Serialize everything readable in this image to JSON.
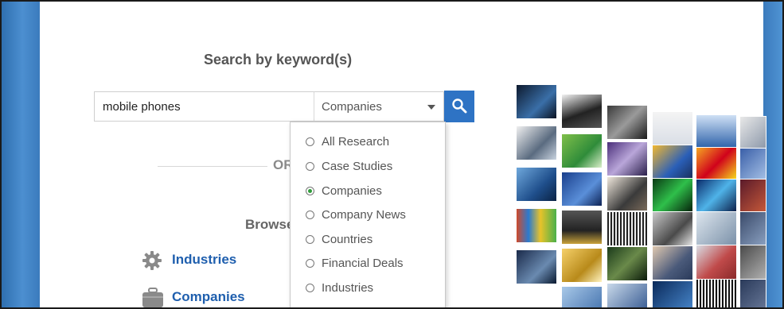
{
  "page": {
    "heading": "Search by keyword(s)",
    "or_text": "OR",
    "browse_text": "Browse"
  },
  "search": {
    "value": "mobile phones",
    "scope_selected": "Companies",
    "button_icon": "search-icon"
  },
  "dropdown": {
    "options": [
      {
        "label": "All Research",
        "selected": false
      },
      {
        "label": "Case Studies",
        "selected": false
      },
      {
        "label": "Companies",
        "selected": true
      },
      {
        "label": "Company News",
        "selected": false
      },
      {
        "label": "Countries",
        "selected": false
      },
      {
        "label": "Financial Deals",
        "selected": false
      },
      {
        "label": "Industries",
        "selected": false
      }
    ]
  },
  "browse": {
    "items": [
      {
        "label": "Industries",
        "icon": "gear-icon"
      },
      {
        "label": "Companies",
        "icon": "briefcase-icon"
      }
    ]
  },
  "colors": {
    "accent": "#2e73c4",
    "link": "#1f5fae",
    "radio_selected": "#2f9c3a",
    "side_blue": "#3b7bbd"
  }
}
